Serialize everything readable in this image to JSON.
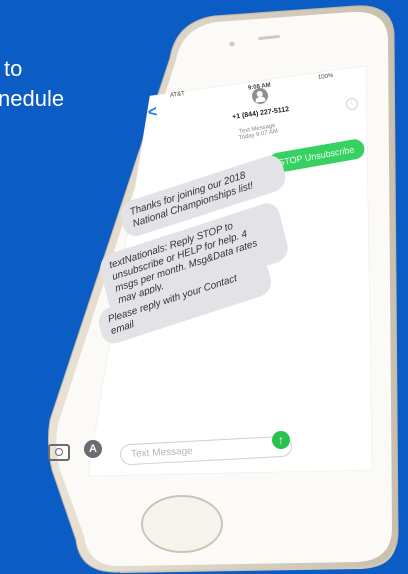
{
  "background_text": {
    "line1": "to",
    "line2": "nedule"
  },
  "status_bar": {
    "carrier": "AT&T",
    "time": "9:08 AM",
    "battery": "100%"
  },
  "conversation": {
    "back_symbol": "<",
    "contact_number": "+1 (844) 227-5112",
    "info_symbol": "i",
    "timestamp_label": "Text Message",
    "timestamp_value": "Today 9:07 AM",
    "outgoing_message": "STOP Unsubscribe",
    "incoming_messages": [
      "Thanks for joining our 2018 National Championships list!",
      "textNationals: Reply STOP to unsubscribe or HELP for help. 4 msgs per month. Msg&Data rates may apply.",
      "Please reply with your Contact email"
    ]
  },
  "input_bar": {
    "placeholder": "Text Message",
    "send_symbol": "↑"
  },
  "colors": {
    "background": "#0b5cc4",
    "bubble_outgoing": "#37d063",
    "bubble_incoming": "#e2e2e7",
    "phone_body": "#f3efe8"
  },
  "icons": [
    "camera-icon",
    "app-store-icon",
    "send-icon",
    "back-chevron-icon",
    "contact-avatar-icon",
    "info-icon"
  ]
}
